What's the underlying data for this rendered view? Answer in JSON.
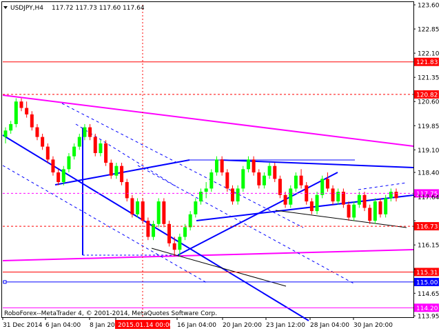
{
  "chart_data": {
    "type": "candlestick",
    "symbol": "USDJPY,H4",
    "ohlc_header": "117.72 117.73 117.60 117.64",
    "ylim": [
      113.95,
      123.6
    ],
    "y_ticks": [
      "123.60",
      "122.85",
      "122.10",
      "121.35",
      "120.60",
      "119.85",
      "119.10",
      "118.40",
      "117.64",
      "116.90",
      "116.15",
      "115.40",
      "114.65",
      "113.95"
    ],
    "x_ticks": [
      "31 Dec 2014",
      "6 Jan 04:00",
      "8 Jan 20:00",
      "2015.01.14 00:00",
      "16 Jan 04:00",
      "20 Jan 20:00",
      "23 Jan 12:00",
      "28 Jan 04:00",
      "30 Jan 20:00"
    ],
    "current_price": 117.64,
    "levels": [
      {
        "label": "121.83",
        "value": 121.83,
        "color": "#ff0000",
        "style": "solid"
      },
      {
        "label": "120.82",
        "value": 120.82,
        "color": "#ff0000",
        "style": "dashed"
      },
      {
        "label": "117.75",
        "value": 117.75,
        "color": "#ff00ff",
        "style": "dashed"
      },
      {
        "label": "116.73",
        "value": 116.73,
        "color": "#ff0000",
        "style": "dashed"
      },
      {
        "label": "115.31",
        "value": 115.31,
        "color": "#ff0000",
        "style": "solid"
      },
      {
        "label": "115.00",
        "value": 115.0,
        "color": "#0000ff",
        "style": "solid"
      },
      {
        "label": "114.20",
        "value": 114.2,
        "color": "#ff00ff",
        "style": "solid"
      }
    ],
    "candles": [
      [
        119.5,
        119.8,
        119.3,
        119.7
      ],
      [
        119.7,
        120.0,
        119.6,
        119.9
      ],
      [
        119.9,
        120.7,
        119.8,
        120.6
      ],
      [
        120.6,
        120.7,
        120.3,
        120.4
      ],
      [
        120.4,
        120.6,
        120.1,
        120.2
      ],
      [
        120.2,
        120.3,
        119.7,
        119.8
      ],
      [
        119.8,
        119.9,
        119.4,
        119.5
      ],
      [
        119.5,
        119.6,
        119.1,
        119.2
      ],
      [
        119.2,
        119.3,
        118.7,
        118.8
      ],
      [
        118.8,
        118.9,
        118.3,
        118.4
      ],
      [
        118.4,
        118.5,
        118.0,
        118.1
      ],
      [
        118.1,
        118.6,
        118.0,
        118.5
      ],
      [
        118.5,
        119.0,
        118.4,
        118.9
      ],
      [
        118.9,
        119.3,
        118.8,
        119.2
      ],
      [
        119.2,
        119.6,
        119.1,
        119.5
      ],
      [
        119.5,
        119.9,
        119.4,
        119.8
      ],
      [
        119.8,
        119.9,
        119.4,
        119.5
      ],
      [
        119.5,
        119.6,
        118.9,
        119.0
      ],
      [
        119.0,
        119.4,
        118.9,
        119.3
      ],
      [
        119.3,
        119.4,
        118.6,
        118.7
      ],
      [
        118.7,
        118.8,
        118.2,
        118.3
      ],
      [
        118.3,
        118.7,
        118.2,
        118.6
      ],
      [
        118.6,
        118.7,
        118.0,
        118.1
      ],
      [
        118.1,
        118.2,
        117.5,
        117.6
      ],
      [
        117.6,
        117.7,
        117.0,
        117.1
      ],
      [
        117.1,
        117.6,
        117.0,
        117.5
      ],
      [
        117.5,
        117.6,
        116.8,
        116.9
      ],
      [
        116.9,
        117.0,
        116.3,
        116.4
      ],
      [
        116.4,
        116.9,
        116.3,
        116.8
      ],
      [
        116.8,
        117.6,
        116.7,
        117.5
      ],
      [
        117.5,
        117.6,
        116.7,
        116.8
      ],
      [
        116.8,
        116.9,
        116.1,
        116.2
      ],
      [
        116.2,
        116.4,
        115.8,
        116.0
      ],
      [
        116.0,
        116.5,
        115.8,
        116.4
      ],
      [
        116.4,
        116.8,
        116.3,
        116.7
      ],
      [
        116.7,
        117.2,
        116.6,
        117.1
      ],
      [
        117.1,
        117.6,
        117.0,
        117.5
      ],
      [
        117.5,
        117.9,
        117.4,
        117.8
      ],
      [
        117.8,
        118.1,
        117.6,
        117.9
      ],
      [
        117.9,
        118.5,
        117.8,
        118.4
      ],
      [
        118.4,
        118.9,
        118.3,
        118.8
      ],
      [
        118.8,
        118.9,
        118.3,
        118.4
      ],
      [
        118.4,
        118.5,
        117.8,
        117.9
      ],
      [
        117.9,
        118.0,
        117.4,
        117.5
      ],
      [
        117.5,
        118.0,
        117.4,
        117.9
      ],
      [
        117.9,
        118.6,
        117.8,
        118.5
      ],
      [
        118.5,
        118.9,
        118.4,
        118.8
      ],
      [
        118.8,
        118.9,
        118.3,
        118.4
      ],
      [
        118.4,
        118.5,
        117.9,
        118.0
      ],
      [
        118.0,
        118.4,
        117.9,
        118.3
      ],
      [
        118.3,
        118.7,
        118.2,
        118.6
      ],
      [
        118.6,
        118.7,
        118.1,
        118.2
      ],
      [
        118.2,
        118.3,
        117.6,
        117.7
      ],
      [
        117.7,
        117.8,
        117.3,
        117.4
      ],
      [
        117.4,
        118.0,
        117.3,
        117.9
      ],
      [
        117.9,
        118.4,
        117.8,
        118.3
      ],
      [
        118.3,
        118.5,
        117.9,
        118.0
      ],
      [
        118.0,
        118.1,
        117.4,
        117.5
      ],
      [
        117.5,
        117.6,
        117.1,
        117.2
      ],
      [
        117.2,
        117.8,
        117.1,
        117.7
      ],
      [
        117.7,
        118.3,
        117.6,
        118.2
      ],
      [
        118.2,
        118.4,
        117.8,
        117.9
      ],
      [
        117.9,
        118.0,
        117.4,
        117.5
      ],
      [
        117.5,
        117.9,
        117.4,
        117.8
      ],
      [
        117.8,
        117.9,
        117.3,
        117.4
      ],
      [
        117.4,
        117.5,
        116.9,
        117.0
      ],
      [
        117.0,
        117.5,
        116.9,
        117.4
      ],
      [
        117.4,
        117.8,
        117.3,
        117.7
      ],
      [
        117.7,
        117.8,
        117.2,
        117.3
      ],
      [
        117.3,
        117.4,
        116.8,
        116.9
      ],
      [
        116.9,
        117.6,
        116.8,
        117.5
      ],
      [
        117.5,
        117.6,
        117.0,
        117.1
      ],
      [
        117.1,
        117.7,
        117.0,
        117.6
      ],
      [
        117.6,
        117.9,
        117.5,
        117.8
      ],
      [
        117.8,
        117.9,
        117.5,
        117.6
      ]
    ],
    "colors": {
      "background": "#ffffff",
      "bull": "#00ff00",
      "bear": "#ff0000",
      "trendline": "#0000ff",
      "channel": "#ff00ff",
      "text": "#000000"
    }
  },
  "footer_text": "RoboForex--MetaTrader 4, © 2001-2014, MetaQuotes Software Corp."
}
